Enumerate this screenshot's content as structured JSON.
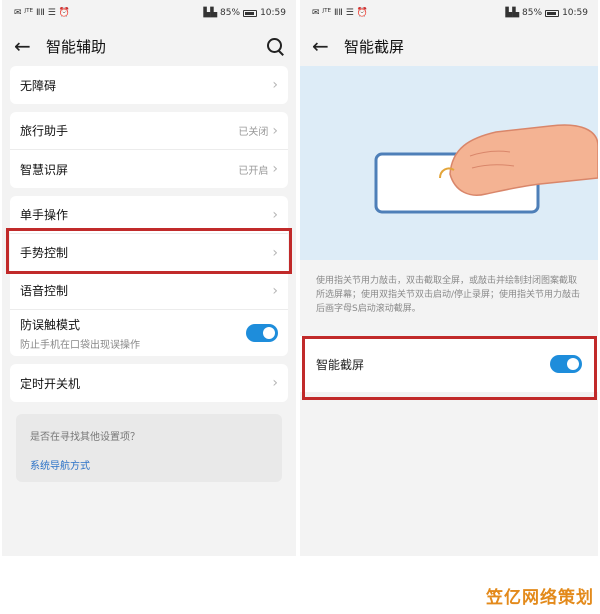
{
  "left": {
    "status": {
      "left": "✉ ᴶᵀᴱ ⅡⅡ ☰ ⏰",
      "battery_text": "▙▙ 85%",
      "time": "10:59"
    },
    "title": "智能辅助",
    "items": [
      {
        "label": "无障碍",
        "value": ""
      },
      {
        "label": "旅行助手",
        "value": "已关闭"
      },
      {
        "label": "智慧识屏",
        "value": "已开启"
      },
      {
        "label": "单手操作",
        "value": ""
      },
      {
        "label": "手势控制",
        "value": ""
      },
      {
        "label": "语音控制",
        "value": ""
      },
      {
        "label": "防误触模式",
        "sub": "防止手机在口袋出现误操作"
      },
      {
        "label": "定时开关机",
        "value": ""
      }
    ],
    "hint": {
      "question": "是否在寻找其他设置项？",
      "link": "系统导航方式"
    }
  },
  "right": {
    "status": {
      "left": "✉ ᴶᵀᴱ ⅡⅡ ☰ ⏰",
      "battery_text": "▙▙ 85%",
      "time": "10:59"
    },
    "title": "智能截屏",
    "description": "使用指关节用力敲击，双击截取全屏，或敲击并绘制封闭图案截取所选屏幕；使用双指关节双击启动/停止录屏；使用指关节用力敲击后画字母S启动滚动截屏。",
    "toggle_label": "智能截屏"
  },
  "colors": {
    "accent": "#1e8ddb",
    "highlight": "#c12a2a",
    "illustration_bg": "#ddecf7",
    "watermark": "#e38a1b"
  },
  "watermark": "笠亿网络策划"
}
